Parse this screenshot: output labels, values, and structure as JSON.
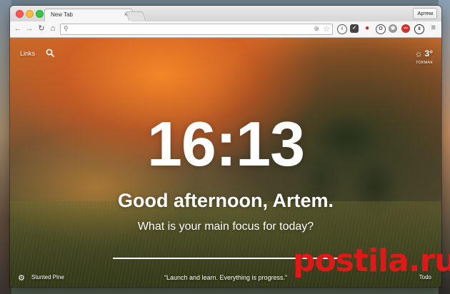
{
  "browser": {
    "tab_title": "New Tab",
    "tab_close": "×",
    "profile_name": "Артем",
    "omnibox_value": "",
    "menu_icon": "hamburger-icon"
  },
  "extensions": [
    {
      "name": "info-extension-icon",
      "glyph": "i",
      "color": "#555555"
    },
    {
      "name": "pocket-icon",
      "glyph": "✓",
      "color": "#444444"
    },
    {
      "name": "redhat-extension-icon",
      "glyph": "●",
      "color": "#cc2222"
    },
    {
      "name": "opera-icon",
      "glyph": "O",
      "color": "#444444"
    },
    {
      "name": "ghostery-icon",
      "glyph": "◉",
      "color": "#777777"
    },
    {
      "name": "lastpass-icon",
      "glyph": "•••",
      "color": "#cc3333"
    },
    {
      "name": "pause-extension-icon",
      "glyph": "II",
      "color": "#222222"
    }
  ],
  "momentum": {
    "links_label": "Links",
    "weather": {
      "temperature": "3°",
      "location": "ТОКМАК",
      "icon": "sun-icon"
    },
    "clock": "16:13",
    "greeting": "Good afternoon, Artem.",
    "focus_question": "What is your main focus for today?",
    "focus_value": "",
    "photo_credit": "Stunted Pine",
    "quote": "“Launch and learn. Everything is progress.”",
    "todo_label": "Todo"
  },
  "watermark": {
    "text": "postila.ru",
    "color": "#e01818"
  }
}
